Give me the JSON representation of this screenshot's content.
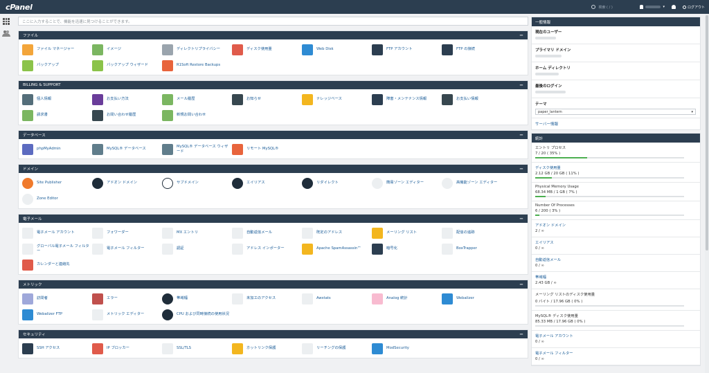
{
  "app": {
    "logo": "cPanel"
  },
  "topbar": {
    "search_placeholder": "検索 ( / )",
    "logout_label": "ログアウト"
  },
  "search": {
    "placeholder": "ここに入力することで、機能を迅速に見つけることができます。"
  },
  "sections": [
    {
      "title": "ファイル",
      "items": [
        {
          "label": "ファイル マネージャー",
          "icon": "file-manager-icon",
          "color": "#f3a53a"
        },
        {
          "label": "イメージ",
          "icon": "images-icon",
          "color": "#7bb661"
        },
        {
          "label": "ディレクトリプライバシー",
          "icon": "directory-privacy-icon",
          "color": "#9aa4ad"
        },
        {
          "label": "ディスク使用量",
          "icon": "disk-usage-icon",
          "color": "#e05b4b"
        },
        {
          "label": "Web Disk",
          "icon": "web-disk-icon",
          "color": "#2e8bd3"
        },
        {
          "label": "FTP アカウント",
          "icon": "ftp-accounts-icon",
          "color": "#2c3e50"
        },
        {
          "label": "FTP の接続",
          "icon": "ftp-connections-icon",
          "color": "#2c3e50"
        },
        {
          "label": "バックアップ",
          "icon": "backup-icon",
          "color": "#8bc34a"
        },
        {
          "label": "バックアップ ウィザード",
          "icon": "backup-wizard-icon",
          "color": "#8bc34a"
        },
        {
          "label": "R1Soft Restore Backups",
          "icon": "r1soft-icon",
          "color": "#e8643c"
        }
      ]
    },
    {
      "title": "BILLING & SUPPORT",
      "items": [
        {
          "label": "個人情報",
          "icon": "personal-info-icon",
          "color": "#546e7a"
        },
        {
          "label": "お支払い方法",
          "icon": "payment-methods-icon",
          "color": "#6a3d9a"
        },
        {
          "label": "メール履歴",
          "icon": "email-history-icon",
          "color": "#7bb661"
        },
        {
          "label": "お知らせ",
          "icon": "announcements-icon",
          "color": "#37474f"
        },
        {
          "label": "ナレッジベース",
          "icon": "knowledgebase-icon",
          "color": "#f3b61f"
        },
        {
          "label": "障害・メンテナンス情報",
          "icon": "network-status-icon",
          "color": "#2c3e50"
        },
        {
          "label": "お支払い情報",
          "icon": "billing-info-icon",
          "color": "#37474f"
        },
        {
          "label": "請求書",
          "icon": "invoices-icon",
          "color": "#7bb661"
        },
        {
          "label": "お問い合わせ履歴",
          "icon": "ticket-history-icon",
          "color": "#37474f"
        },
        {
          "label": "新規お問い合わせ",
          "icon": "new-ticket-icon",
          "color": "#7bb661"
        }
      ]
    },
    {
      "title": "データベース",
      "items": [
        {
          "label": "phpMyAdmin",
          "icon": "phpmyadmin-icon",
          "color": "#5c6bc0"
        },
        {
          "label": "MySQL® データベース",
          "icon": "mysql-databases-icon",
          "color": "#607d8b"
        },
        {
          "label": "MySQL® データベース ウィザード",
          "icon": "mysql-wizard-icon",
          "color": "#607d8b"
        },
        {
          "label": "リモート MySQL®",
          "icon": "remote-mysql-icon",
          "color": "#e8643c"
        }
      ]
    },
    {
      "title": "ドメイン",
      "items": [
        {
          "label": "Site Publisher",
          "icon": "site-publisher-icon",
          "color": "#f07a2c",
          "round": true
        },
        {
          "label": "アドオン ドメイン",
          "icon": "addon-domains-icon",
          "color": "#1f2d3a",
          "round": true
        },
        {
          "label": "サブドメイン",
          "icon": "subdomains-icon",
          "color": "#ffffff",
          "round": true
        },
        {
          "label": "エイリアス",
          "icon": "aliases-icon",
          "color": "#1f2d3a",
          "round": true
        },
        {
          "label": "リダイレクト",
          "icon": "redirects-icon",
          "color": "#1f2d3a",
          "round": true
        },
        {
          "label": "簡易ゾーン エディター",
          "icon": "simple-zone-editor-icon",
          "color": "#eceff1",
          "round": true
        },
        {
          "label": "高機能ゾーン エディター",
          "icon": "advanced-zone-editor-icon",
          "color": "#eceff1",
          "round": true
        },
        {
          "label": "Zone Editor",
          "icon": "zone-editor-icon",
          "color": "#eceff1",
          "round": true
        }
      ]
    },
    {
      "title": "電子メール",
      "items": [
        {
          "label": "電子メール アカウント",
          "icon": "email-accounts-icon",
          "color": "#eceff1"
        },
        {
          "label": "フォワーダー",
          "icon": "forwarders-icon",
          "color": "#eceff1"
        },
        {
          "label": "MX エントリ",
          "icon": "mx-entry-icon",
          "color": "#eceff1"
        },
        {
          "label": "自動返信メール",
          "icon": "autoresponders-icon",
          "color": "#eceff1"
        },
        {
          "label": "既定のアドレス",
          "icon": "default-address-icon",
          "color": "#eceff1"
        },
        {
          "label": "メーリング リスト",
          "icon": "mailing-lists-icon",
          "color": "#f3b61f"
        },
        {
          "label": "配信の追跡",
          "icon": "track-delivery-icon",
          "color": "#eceff1"
        },
        {
          "label": "グローバル電子メール フィルター",
          "icon": "global-email-filters-icon",
          "color": "#eceff1"
        },
        {
          "label": "電子メール フィルター",
          "icon": "email-filters-icon",
          "color": "#eceff1"
        },
        {
          "label": "認証",
          "icon": "authentication-icon",
          "color": "#eceff1"
        },
        {
          "label": "アドレス インポーター",
          "icon": "address-importer-icon",
          "color": "#eceff1"
        },
        {
          "label": "Apache SpamAssassin™",
          "icon": "spamassassin-icon",
          "color": "#f3b61f"
        },
        {
          "label": "暗号化",
          "icon": "encryption-icon",
          "color": "#2c3e50"
        },
        {
          "label": "BoxTrapper",
          "icon": "boxtrapper-icon",
          "color": "#eceff1"
        },
        {
          "label": "カレンダーと連絡先",
          "icon": "calendars-contacts-icon",
          "color": "#e05b4b"
        }
      ]
    },
    {
      "title": "メトリック",
      "items": [
        {
          "label": "訪問者",
          "icon": "visitors-icon",
          "color": "#9fa8da"
        },
        {
          "label": "エラー",
          "icon": "errors-icon",
          "color": "#c0504d"
        },
        {
          "label": "帯域幅",
          "icon": "bandwidth-icon",
          "color": "#1f2d3a",
          "round": true
        },
        {
          "label": "未加工のアクセス",
          "icon": "raw-access-icon",
          "color": "#eceff1"
        },
        {
          "label": "Awstats",
          "icon": "awstats-icon",
          "color": "#eceff1"
        },
        {
          "label": "Analog 統計",
          "icon": "analog-stats-icon",
          "color": "#f8bbd0"
        },
        {
          "label": "Webalizer",
          "icon": "webalizer-icon",
          "color": "#2e8bd3"
        },
        {
          "label": "Webalizer FTP",
          "icon": "webalizer-ftp-icon",
          "color": "#2e8bd3"
        },
        {
          "label": "メトリック エディター",
          "icon": "metrics-editor-icon",
          "color": "#eceff1"
        },
        {
          "label": "CPU および同時接続の使用状況",
          "icon": "cpu-usage-icon",
          "color": "#1f2d3a",
          "round": true
        }
      ]
    },
    {
      "title": "セキュリティ",
      "items": [
        {
          "label": "SSH アクセス",
          "icon": "ssh-access-icon",
          "color": "#2c3e50"
        },
        {
          "label": "IP ブロッカー",
          "icon": "ip-blocker-icon",
          "color": "#e05b4b"
        },
        {
          "label": "SSL/TLS",
          "icon": "ssl-tls-icon",
          "color": "#eceff1"
        },
        {
          "label": "ホットリンク保護",
          "icon": "hotlink-protection-icon",
          "color": "#f3b61f"
        },
        {
          "label": "リーチングの保護",
          "icon": "leech-protection-icon",
          "color": "#eceff1"
        },
        {
          "label": "ModSecurity",
          "icon": "modsecurity-icon",
          "color": "#2e8bd3"
        }
      ]
    }
  ],
  "general": {
    "title": "一般情報",
    "current_user": "現在のユーザー",
    "primary_domain": "プライマリ ドメイン",
    "home_directory": "ホーム ディレクトリ",
    "last_login": "最後のログイン",
    "theme_label": "テーマ",
    "theme_value": "paper_lantern",
    "server_info": "サーバー情報"
  },
  "stats": {
    "title": "統計",
    "items": [
      {
        "name": "エントリ プロセス",
        "value": "7 / 20 ( 35% )",
        "percent": 35,
        "link": false
      },
      {
        "name": "ディスク使用量",
        "value": "2.12 GB / 20 GB ( 11% )",
        "percent": 11,
        "link": true
      },
      {
        "name": "Physical Memory Usage",
        "value": "68.34 MB / 1 GB ( 7% )",
        "percent": 7,
        "link": false
      },
      {
        "name": "Number Of Processes",
        "value": "6 / 200 ( 3% )",
        "percent": 3,
        "link": false
      },
      {
        "name": "アドオン ドメイン",
        "value": "2 / ∞",
        "link": true
      },
      {
        "name": "エイリアス",
        "value": "0 / ∞",
        "link": true
      },
      {
        "name": "自動返信メール",
        "value": "0 / ∞",
        "link": true
      },
      {
        "name": "帯域幅",
        "value": "2.43 GB / ∞",
        "link": true
      },
      {
        "name": "メーリング リストのディスク使用量",
        "value": "0 バイト / 17.96 GB ( 0% )",
        "percent": 0,
        "link": false
      },
      {
        "name": "MySQL® ディスク使用量",
        "value": "85.33 MB / 17.96 GB ( 0% )",
        "percent": 0,
        "link": false
      },
      {
        "name": "電子メール アカウント",
        "value": "0 / ∞",
        "link": true
      },
      {
        "name": "電子メール フィルター",
        "value": "0 / ∞",
        "link": true
      }
    ]
  }
}
